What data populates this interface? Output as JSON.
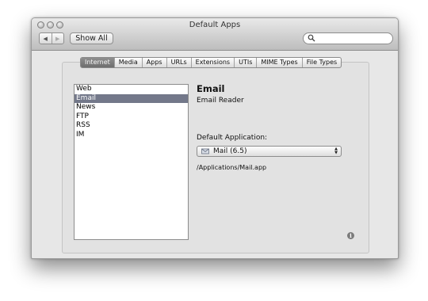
{
  "window": {
    "title": "Default Apps"
  },
  "toolbar": {
    "back_glyph": "◀",
    "forward_glyph": "▶",
    "show_all_label": "Show All",
    "search_placeholder": "",
    "search_icon": "magnifier-icon"
  },
  "tabs": [
    {
      "label": "Internet",
      "active": true
    },
    {
      "label": "Media",
      "active": false
    },
    {
      "label": "Apps",
      "active": false
    },
    {
      "label": "URLs",
      "active": false
    },
    {
      "label": "Extensions",
      "active": false
    },
    {
      "label": "UTIs",
      "active": false
    },
    {
      "label": "MIME Types",
      "active": false
    },
    {
      "label": "File Types",
      "active": false
    }
  ],
  "list": {
    "items": [
      {
        "label": "Web",
        "selected": false
      },
      {
        "label": "Email",
        "selected": true
      },
      {
        "label": "News",
        "selected": false
      },
      {
        "label": "FTP",
        "selected": false
      },
      {
        "label": "RSS",
        "selected": false
      },
      {
        "label": "IM",
        "selected": false
      }
    ]
  },
  "detail": {
    "title": "Email",
    "subtitle": "Email Reader",
    "default_label": "Default Application:",
    "app_value": "Mail (6.5)",
    "app_icon": "mail-app-icon",
    "app_path": "/Applications/Mail.app"
  },
  "info_glyph": "i",
  "colors": {
    "selection": "#73788a",
    "active_tab": "#7c7c7c"
  }
}
